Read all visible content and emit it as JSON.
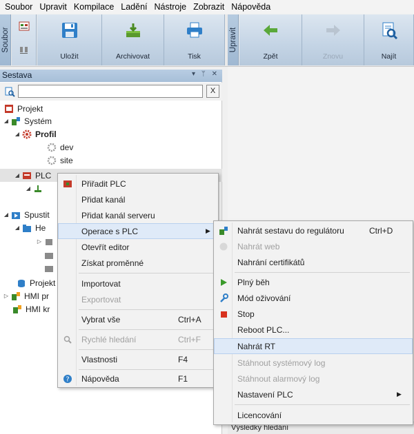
{
  "menubar": [
    "Soubor",
    "Upravit",
    "Kompilace",
    "Ladění",
    "Nástroje",
    "Zobrazit",
    "Nápověda"
  ],
  "ribbon": {
    "group1_label": "Soubor",
    "save": "Uložit",
    "archive": "Archivovat",
    "print": "Tisk",
    "group2_label": "Upravit",
    "back": "Zpět",
    "forward": "Znovu",
    "find": "Najít"
  },
  "panel": {
    "title": "Sestava",
    "controls": "▾ ᛘ ✕",
    "search_value": "",
    "clear": "X"
  },
  "tree": {
    "project": "Projekt",
    "system": "Systém",
    "profile": "Profil",
    "dev": "dev",
    "site": "site",
    "plc": "PLC",
    "run": "Spustit",
    "he": "He",
    "projekt2": "Projekt",
    "hmi1": "HMI pr",
    "hmi2": "HMI kr"
  },
  "context_menu": {
    "items": [
      {
        "label": "Přiřadit PLC",
        "shortcut": ""
      },
      {
        "label": "Přidat kanál",
        "shortcut": ""
      },
      {
        "label": "Přidat kanál serveru",
        "shortcut": ""
      },
      {
        "label": "Operace s PLC",
        "shortcut": ""
      },
      {
        "label": "Otevřít editor",
        "shortcut": ""
      },
      {
        "label": "Získat proměnné",
        "shortcut": ""
      },
      {
        "label": "Importovat",
        "shortcut": ""
      },
      {
        "label": "Exportovat",
        "shortcut": ""
      },
      {
        "label": "Vybrat vše",
        "shortcut": "Ctrl+A"
      },
      {
        "label": "Rychlé hledání",
        "shortcut": "Ctrl+F"
      },
      {
        "label": "Vlastnosti",
        "shortcut": "F4"
      },
      {
        "label": "Nápověda",
        "shortcut": "F1"
      }
    ]
  },
  "submenu": {
    "items": [
      {
        "label": "Nahrát sestavu do regulátoru",
        "shortcut": "Ctrl+D"
      },
      {
        "label": "Nahrát web",
        "shortcut": ""
      },
      {
        "label": "Nahrání certifikátů",
        "shortcut": ""
      },
      {
        "label": "Plný běh",
        "shortcut": ""
      },
      {
        "label": "Mód oživování",
        "shortcut": ""
      },
      {
        "label": "Stop",
        "shortcut": ""
      },
      {
        "label": "Reboot PLC...",
        "shortcut": ""
      },
      {
        "label": "Nahrát RT",
        "shortcut": ""
      },
      {
        "label": "Stáhnout systémový log",
        "shortcut": ""
      },
      {
        "label": "Stáhnout alarmový log",
        "shortcut": ""
      },
      {
        "label": "Nastavení PLC",
        "shortcut": ""
      },
      {
        "label": "Licencování",
        "shortcut": ""
      }
    ]
  },
  "results_tab": "Výsledky hledání",
  "colors": {
    "accent": "#dfeaf8",
    "ribbon": "#c4d4e5",
    "panel_header": "#b8cde3"
  }
}
